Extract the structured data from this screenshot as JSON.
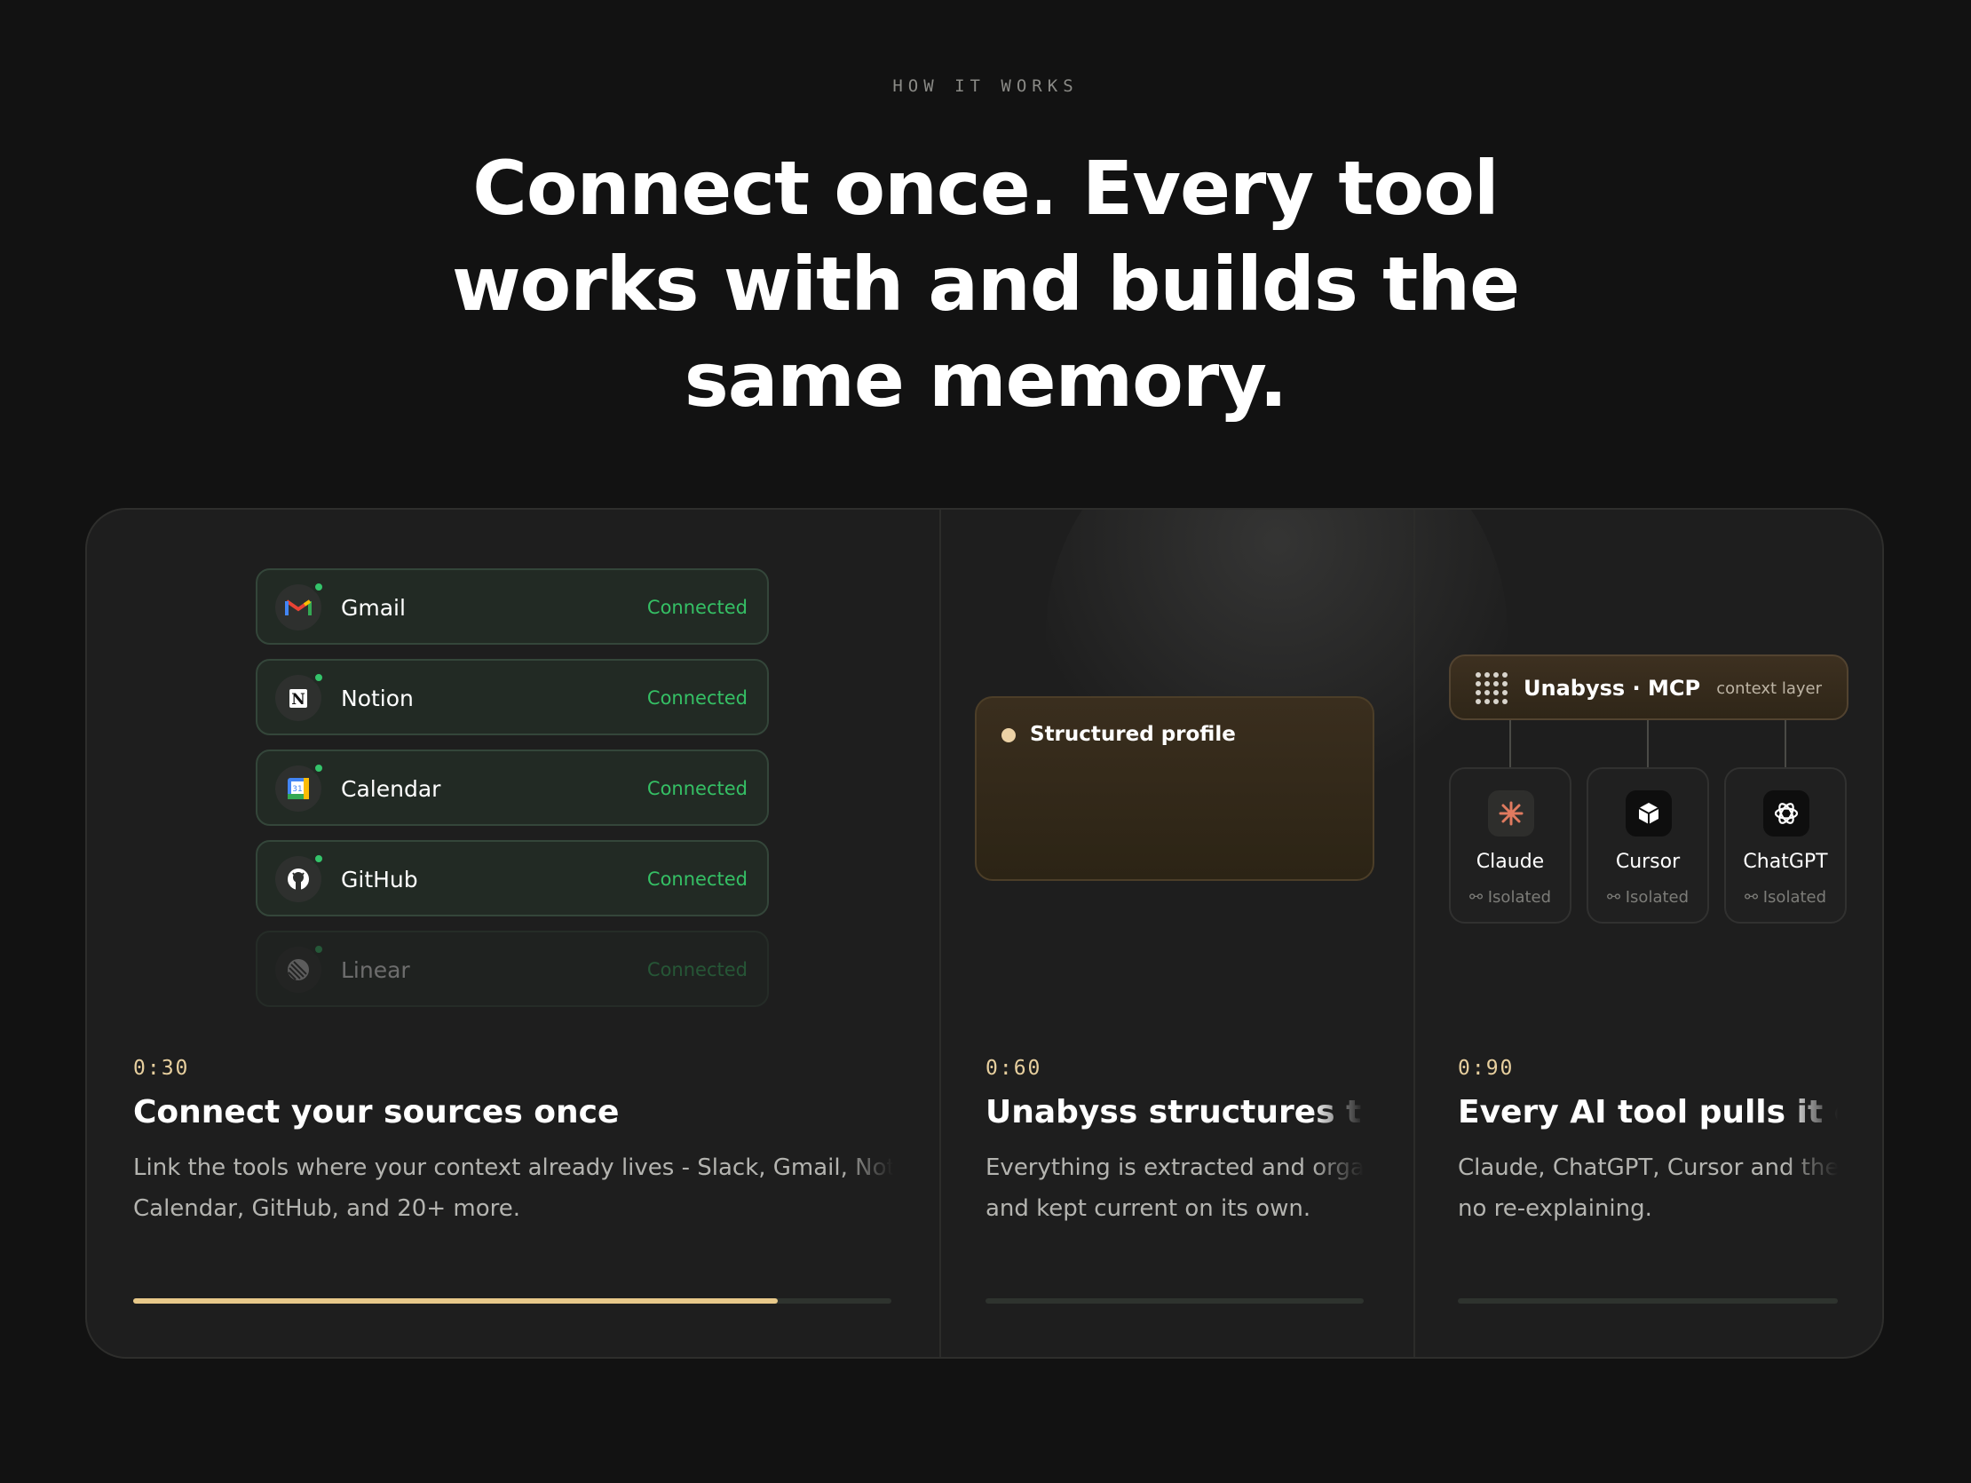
{
  "section": {
    "eyebrow": "HOW IT WORKS",
    "headline_line1": "Connect once. Every tool",
    "headline_line2": "works with and builds the",
    "headline_line3": "same memory."
  },
  "colors": {
    "accent": "#e8c98a",
    "connected": "#35c065",
    "background": "#121212",
    "card": "#1e1e1e"
  },
  "sources": [
    {
      "name": "Gmail",
      "status": "Connected",
      "icon": "gmail-icon"
    },
    {
      "name": "Notion",
      "status": "Connected",
      "icon": "notion-icon"
    },
    {
      "name": "Calendar",
      "status": "Connected",
      "icon": "calendar-icon"
    },
    {
      "name": "GitHub",
      "status": "Connected",
      "icon": "github-icon"
    },
    {
      "name": "Linear",
      "status": "Connected",
      "icon": "linear-icon"
    }
  ],
  "profile": {
    "label": "Structured profile"
  },
  "mcp": {
    "name": "Unabyss · MCP",
    "tag": "context layer"
  },
  "tools": [
    {
      "name": "Claude",
      "status": "Isolated",
      "icon": "claude-icon"
    },
    {
      "name": "Cursor",
      "status": "Isolated",
      "icon": "cursor-icon"
    },
    {
      "name": "ChatGPT",
      "status": "Isolated",
      "icon": "chatgpt-icon"
    }
  ],
  "steps": [
    {
      "time": "0:30",
      "title": "Connect your sources once",
      "desc_line1": "Link the tools where your context already lives - Slack, Gmail, Notic",
      "desc_line2": "Calendar, GitHub, and 20+ more.",
      "progress": 0.85
    },
    {
      "time": "0:60",
      "title": "Unabyss structures then",
      "desc_line1": "Everything is extracted and orga",
      "desc_line2": "and kept current on its own.",
      "progress": 0
    },
    {
      "time": "0:90",
      "title": "Every AI tool pulls it ove",
      "desc_line1": "Claude, ChatGPT, Cursor and the",
      "desc_line2": "no re-explaining.",
      "progress": 0
    }
  ]
}
